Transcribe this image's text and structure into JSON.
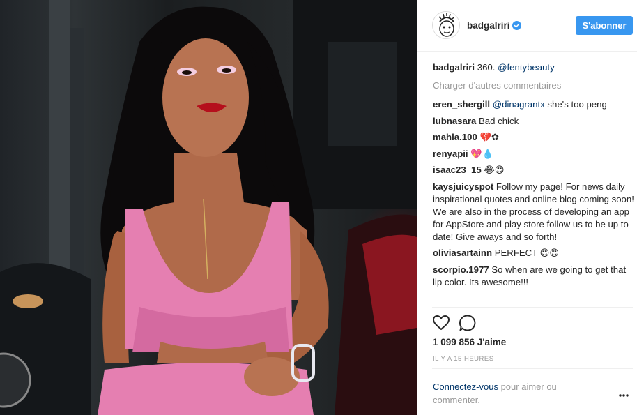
{
  "post": {
    "username": "badgalriri",
    "verified": true,
    "follow_label": "S'abonner",
    "caption": {
      "user": "badgalriri",
      "text": "360.",
      "mention": "@fentybeauty"
    },
    "load_more_label": "Charger d'autres commentaires",
    "comments": [
      {
        "user": "eren_shergill",
        "mention": "@dinagrantx",
        "text": "she's too peng"
      },
      {
        "user": "lubnasara",
        "mention": "",
        "text": "Bad chick"
      },
      {
        "user": "mahla.100",
        "mention": "",
        "text": "💔✿"
      },
      {
        "user": "renyapii",
        "mention": "",
        "text": "💖💧"
      },
      {
        "user": "isaac23_15",
        "mention": "",
        "text": "😂😍"
      },
      {
        "user": "kaysjuicyspot",
        "mention": "",
        "text": "Follow my page! For news daily inspirational quotes and online blog coming soon! We are also in the process of developing an app for AppStore and play store follow us to be up to date! Give aways and so forth!"
      },
      {
        "user": "oliviasartainn",
        "mention": "",
        "text": "PERFECT 😍😍"
      },
      {
        "user": "scorpio.1977",
        "mention": "",
        "text": "So when are we going to get that lip color. Its awesome!!!"
      }
    ],
    "likes": "1 099 856 J'aime",
    "timestamp": "IL Y A 15 HEURES",
    "login_prompt": {
      "link": "Connectez-vous",
      "text": "pour aimer ou commenter."
    },
    "icons": {
      "like": "heart-icon",
      "comment": "comment-icon",
      "more": "more-options-icon",
      "verified": "verified-badge-icon"
    },
    "colors": {
      "accent": "#3897f0",
      "mention": "#003569",
      "muted": "#999999",
      "text": "#262626",
      "dress": "#e57fb1"
    }
  }
}
